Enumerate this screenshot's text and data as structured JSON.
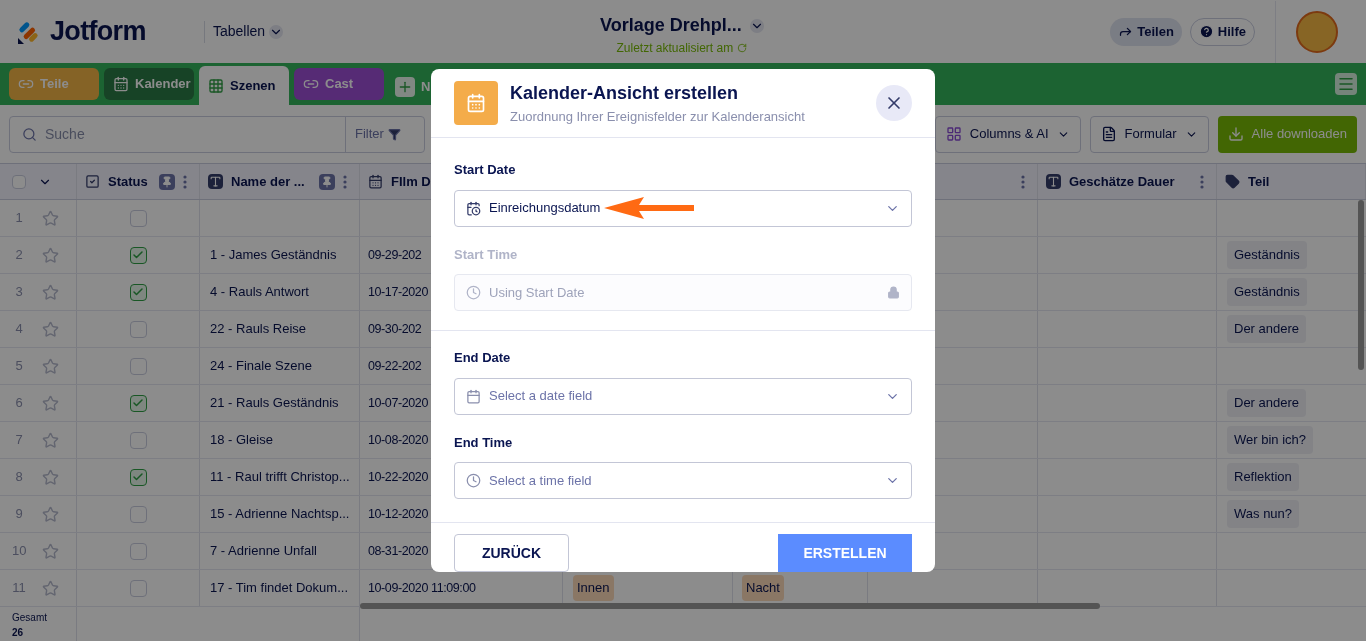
{
  "header": {
    "logo": "Jotform",
    "menu": "Tabellen",
    "doc_title": "Vorlage Drehpl...",
    "doc_subtitle": "Zuletzt aktualisiert am",
    "buttons": [
      {
        "label": "Teilen",
        "kind": "share"
      },
      {
        "label": "Hilfe",
        "kind": "help"
      }
    ]
  },
  "tabs": [
    {
      "label": "Teile",
      "kind": "amber",
      "selected": false
    },
    {
      "label": "Kalender",
      "kind": "forest",
      "selected": false
    },
    {
      "label": "Szenen",
      "kind": "table",
      "selected": true
    },
    {
      "label": "Cast",
      "kind": "violet",
      "selected": false
    }
  ],
  "add_tab": "N",
  "toolbar": {
    "search_placeholder": "Suche",
    "filter": "Filter",
    "buttons": [
      {
        "label": "Columns & AI",
        "kind": "columns"
      },
      {
        "label": "Formular",
        "kind": "form"
      },
      {
        "label": "Alle downloaden",
        "kind": "download"
      }
    ]
  },
  "table": {
    "select_all_checked": false,
    "columns": [
      {
        "label": "Status",
        "kind": "checkbox",
        "pinned": true,
        "menu": true
      },
      {
        "label": "Name der ...",
        "kind": "text",
        "pinned": true,
        "menu": true
      },
      {
        "label": "FIlm D",
        "kind": "date"
      },
      {
        "kind": "blank",
        "pinned": false,
        "menu": true
      },
      {
        "label": "Geschätze Dauer",
        "kind": "text",
        "pinned": false,
        "menu": true
      },
      {
        "label": "Teil",
        "kind": "tag",
        "pinned": false,
        "menu": false
      }
    ],
    "rows": [
      {
        "number": "1",
        "checked": false
      },
      {
        "number": "2",
        "checked": true,
        "name": "1 - James Geständnis",
        "date": "09-29-202",
        "teil": "Geständnis"
      },
      {
        "number": "3",
        "checked": true,
        "name": "4 - Rauls Antwort",
        "date": "10-17-2020",
        "teil": "Geständnis"
      },
      {
        "number": "4",
        "checked": false,
        "name": "22 - Rauls Reise",
        "date": "09-30-202",
        "teil": "Der andere"
      },
      {
        "number": "5",
        "checked": false,
        "name": "24 - Finale Szene",
        "date": "09-22-202"
      },
      {
        "number": "6",
        "checked": true,
        "name": "21 - Rauls Geständnis",
        "date": "10-07-2020",
        "teil": "Der andere"
      },
      {
        "number": "7",
        "checked": false,
        "name": "18 - Gleise",
        "date": "10-08-2020",
        "teil": "Wer bin ich?"
      },
      {
        "number": "8",
        "checked": true,
        "name": "11 - Raul trifft Christop...",
        "date": "10-22-2020",
        "teil": "Reflektion"
      },
      {
        "number": "9",
        "checked": false,
        "name": "15 - Adrienne Nachtsp...",
        "date": "10-12-2020",
        "teil": "Was nun?"
      },
      {
        "number": "10",
        "checked": false,
        "name": "7 - Adrienne Unfall",
        "date": "08-31-2020"
      },
      {
        "number": "11",
        "checked": false,
        "name": "17 - Tim findet Dokum...",
        "date": "10-09-2020 11:09:00",
        "col4": "Innen",
        "col5": "Nacht"
      }
    ],
    "footer": {
      "label": "Gesamt",
      "count": "26"
    }
  },
  "dialog": {
    "title": "Kalender-Ansicht erstellen",
    "subtitle": "Zuordnung Ihrer Ereignisfelder zur Kalenderansicht",
    "sections": [
      [
        {
          "label": "Start Date",
          "value": "Einreichungsdatum",
          "kind": "datetime",
          "disabled": false,
          "pointer": true
        },
        {
          "label": "Start Time",
          "placeholder": "Using Start Date",
          "kind": "time",
          "disabled": true,
          "pointer": false
        }
      ],
      [
        {
          "label": "End Date",
          "placeholder": "Select a date field",
          "kind": "date",
          "disabled": false,
          "pointer": false
        },
        {
          "label": "End Time",
          "placeholder": "Select a time field",
          "kind": "time",
          "disabled": false,
          "pointer": false
        }
      ]
    ],
    "back": "ZURÜCK",
    "create": "ERSTELLEN"
  }
}
